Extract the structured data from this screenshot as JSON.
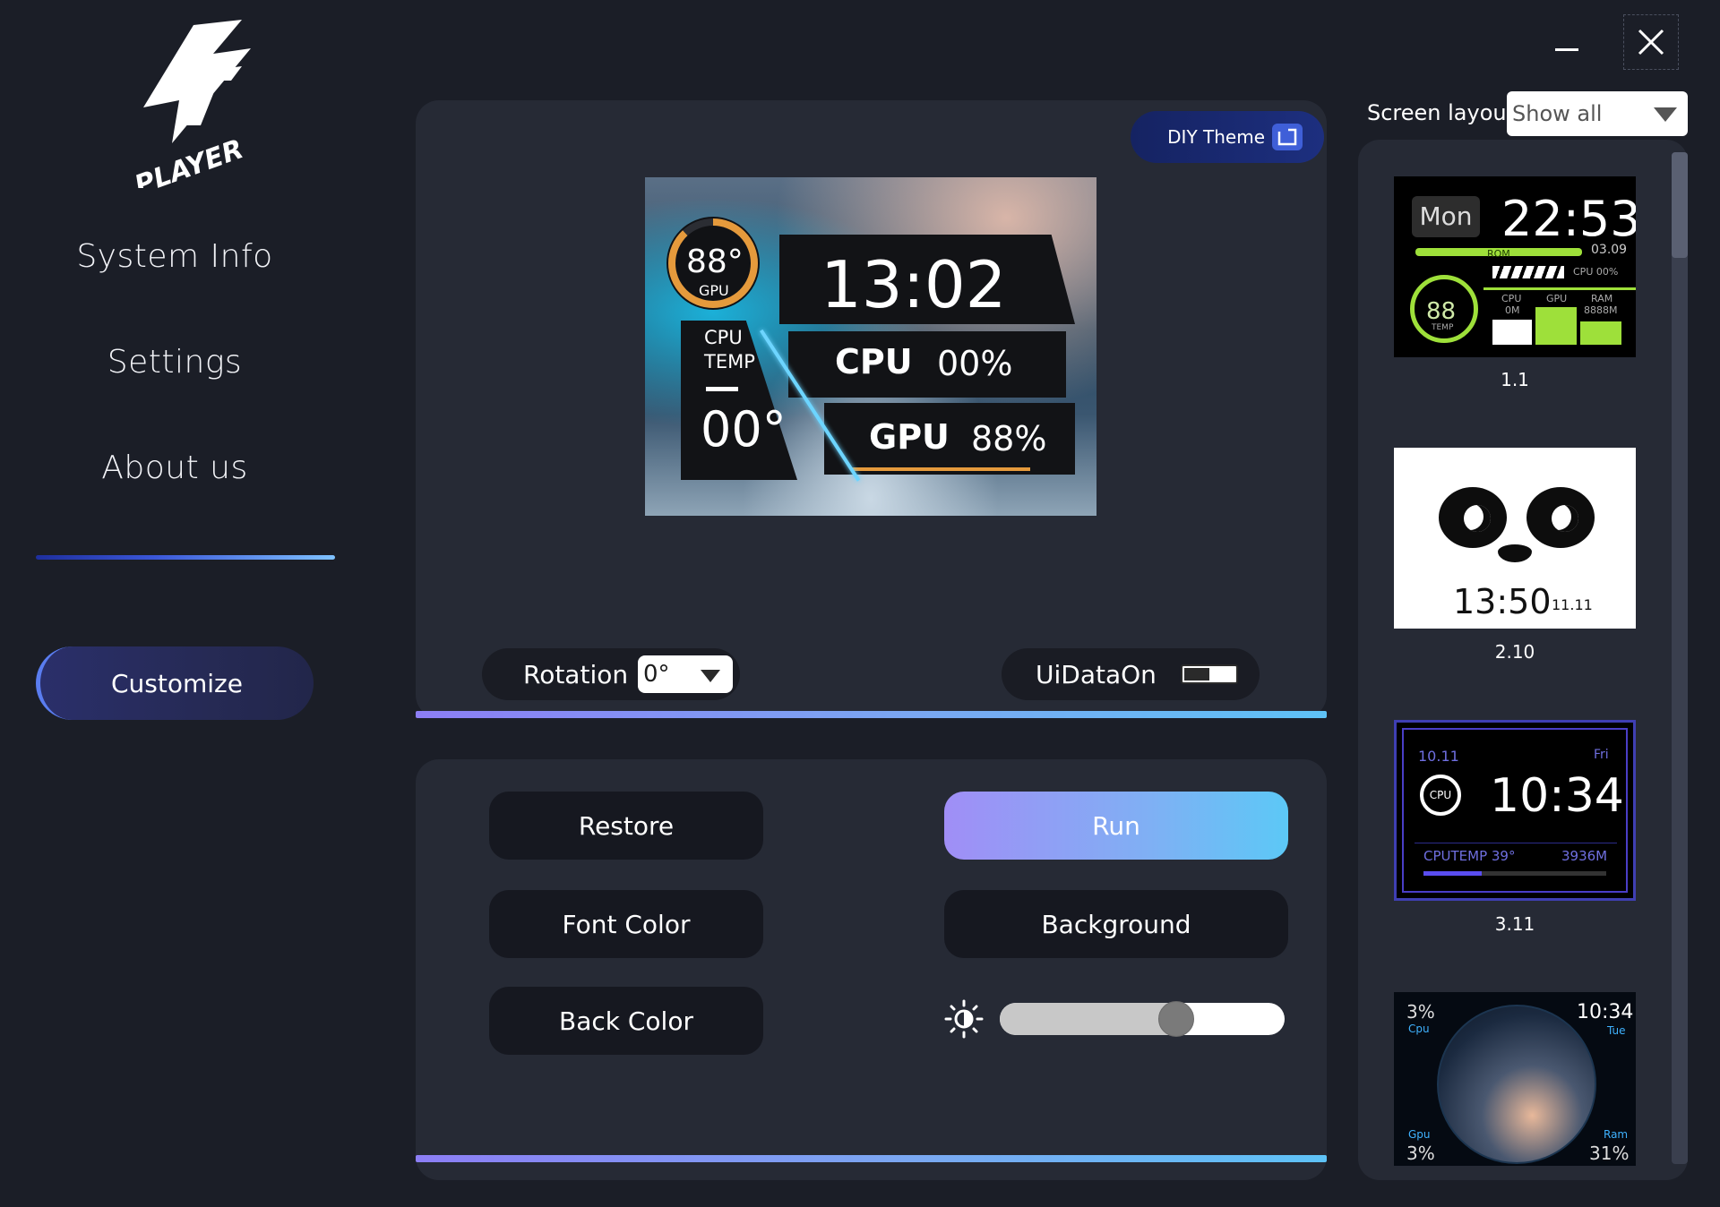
{
  "sidebar": {
    "nav": [
      "System Info",
      "Settings",
      "About us"
    ],
    "customize_label": "Customize"
  },
  "preview": {
    "diy_theme_label": "DIY Theme",
    "gpu_temp": "88°",
    "gpu_label": "GPU",
    "time": "13:02",
    "cpu_temp_label_1": "CPU",
    "cpu_temp_label_2": "TEMP",
    "cpu_temp": "00°",
    "cpu_label": "CPU",
    "cpu_value": "00%",
    "gpu_usage_label": "GPU",
    "gpu_value": "88%",
    "gpu_ring_fraction": 0.88
  },
  "controls": {
    "rotation_label": "Rotation",
    "rotation_value": "0°",
    "uidata_label": "UiDataOn",
    "uidata_on": false,
    "restore_label": "Restore",
    "run_label": "Run",
    "font_color_label": "Font Color",
    "background_label": "Background",
    "back_color_label": "Back Color",
    "brightness_fraction": 0.62
  },
  "layouts": {
    "screen_layout_label": "Screen layout",
    "screen_layout_value": "Show all",
    "items": [
      {
        "label": "1.1",
        "day": "Mon",
        "time": "22:53",
        "date": "03.09",
        "temp": "88",
        "temp_label": "TEMP",
        "rom_label": "ROM",
        "cpu_small": "CPU 00%",
        "cpu_label": "CPU",
        "cpu_val": "0M",
        "gpu_label": "GPU",
        "ram_label": "RAM",
        "ram_val": "8888M"
      },
      {
        "label": "2.10",
        "time": "13:50",
        "date": "11.11"
      },
      {
        "label": "3.11",
        "date": "10.11",
        "day": "Fri",
        "cpu": "CPU",
        "time": "10:34",
        "cputemp": "CPUTEMP 39°",
        "ram": "3936M",
        "progress_fraction": 0.32
      },
      {
        "cpu_pct": "3%",
        "cpu_label": "Cpu",
        "time": "10:34",
        "day": "Tue",
        "gpu_label": "Gpu",
        "gpu_pct": "3%",
        "ram_label": "Ram",
        "ram_pct": "31%"
      }
    ]
  },
  "colors": {
    "accent_run_start": "#a08ef6",
    "accent_run_end": "#5cc8f6",
    "panel_bg": "#262a35",
    "app_bg": "#1b1e27",
    "thumb1_green": "#9ee03a",
    "gpu_ring_orange": "#e59a3c"
  }
}
